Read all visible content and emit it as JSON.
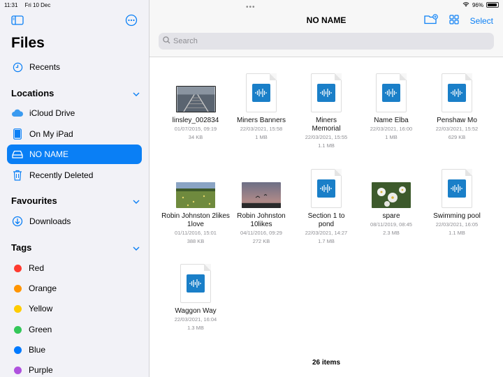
{
  "status": {
    "time": "11:31",
    "date": "Fri 10 Dec",
    "battery": "96%"
  },
  "sidebar": {
    "title": "Files",
    "recents": "Recents",
    "locations_header": "Locations",
    "locations": [
      {
        "label": "iCloud Drive",
        "icon": "cloud-icon"
      },
      {
        "label": "On My iPad",
        "icon": "ipad-icon"
      },
      {
        "label": "NO NAME",
        "icon": "drive-icon",
        "selected": true
      },
      {
        "label": "Recently Deleted",
        "icon": "trash-icon"
      }
    ],
    "favourites_header": "Favourites",
    "favourites": [
      {
        "label": "Downloads",
        "icon": "download-icon"
      }
    ],
    "tags_header": "Tags",
    "tags": [
      {
        "label": "Red",
        "color": "#ff3b30"
      },
      {
        "label": "Orange",
        "color": "#ff9500"
      },
      {
        "label": "Yellow",
        "color": "#ffcc00"
      },
      {
        "label": "Green",
        "color": "#34c759"
      },
      {
        "label": "Blue",
        "color": "#007aff"
      },
      {
        "label": "Purple",
        "color": "#af52de"
      }
    ]
  },
  "main": {
    "title": "NO NAME",
    "select_label": "Select",
    "search_placeholder": "Search",
    "item_count": "26 items",
    "files": [
      {
        "name": "linsley_002834",
        "date": "01/07/2015, 09:19",
        "size": "34 KB",
        "kind": "photo",
        "thumb": "rails"
      },
      {
        "name": "Miners Banners",
        "date": "22/03/2021, 15:58",
        "size": "1 MB",
        "kind": "audio"
      },
      {
        "name": "Miners Memorial",
        "date": "22/03/2021, 15:55",
        "size": "1.1 MB",
        "kind": "audio"
      },
      {
        "name": "Name Elba",
        "date": "22/03/2021, 16:00",
        "size": "1 MB",
        "kind": "audio"
      },
      {
        "name": "Penshaw Mo",
        "date": "22/03/2021, 15:52",
        "size": "629 KB",
        "kind": "audio"
      },
      {
        "name": "Robin Johnston 2likes 1love",
        "date": "01/11/2016, 15:01",
        "size": "388 KB",
        "kind": "photo",
        "thumb": "field"
      },
      {
        "name": "Robin Johnston 10likes",
        "date": "04/11/2016, 09:29",
        "size": "272 KB",
        "kind": "photo",
        "thumb": "dusk"
      },
      {
        "name": "Section 1 to pond",
        "date": "22/03/2021, 14:27",
        "size": "1.7 MB",
        "kind": "audio"
      },
      {
        "name": "spare",
        "date": "08/11/2019, 08:45",
        "size": "2.3 MB",
        "kind": "photo",
        "thumb": "flowers"
      },
      {
        "name": "Swimming pool",
        "date": "22/03/2021, 16:05",
        "size": "1.1 MB",
        "kind": "audio"
      },
      {
        "name": "Waggon Way",
        "date": "22/03/2021, 16:04",
        "size": "1.3 MB",
        "kind": "audio"
      }
    ]
  },
  "colors": {
    "accent": "#0a7ff5",
    "audio_icon": "#1a7fc8"
  }
}
